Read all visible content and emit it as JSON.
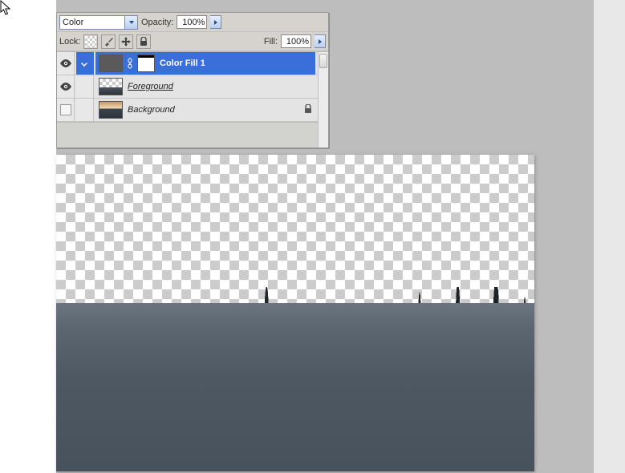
{
  "panel": {
    "blend_mode": "Color",
    "opacity_label": "Opacity:",
    "opacity_value": "100%",
    "lock_label": "Lock:",
    "fill_label": "Fill:",
    "fill_value": "100%"
  },
  "layers": [
    {
      "name": "Color Fill 1",
      "visible": true,
      "selected": true,
      "locked": false,
      "type": "adjustment"
    },
    {
      "name": "Foreground",
      "visible": true,
      "selected": false,
      "locked": false,
      "type": "foreground"
    },
    {
      "name": "Background",
      "visible": false,
      "selected": false,
      "locked": true,
      "type": "background"
    }
  ]
}
